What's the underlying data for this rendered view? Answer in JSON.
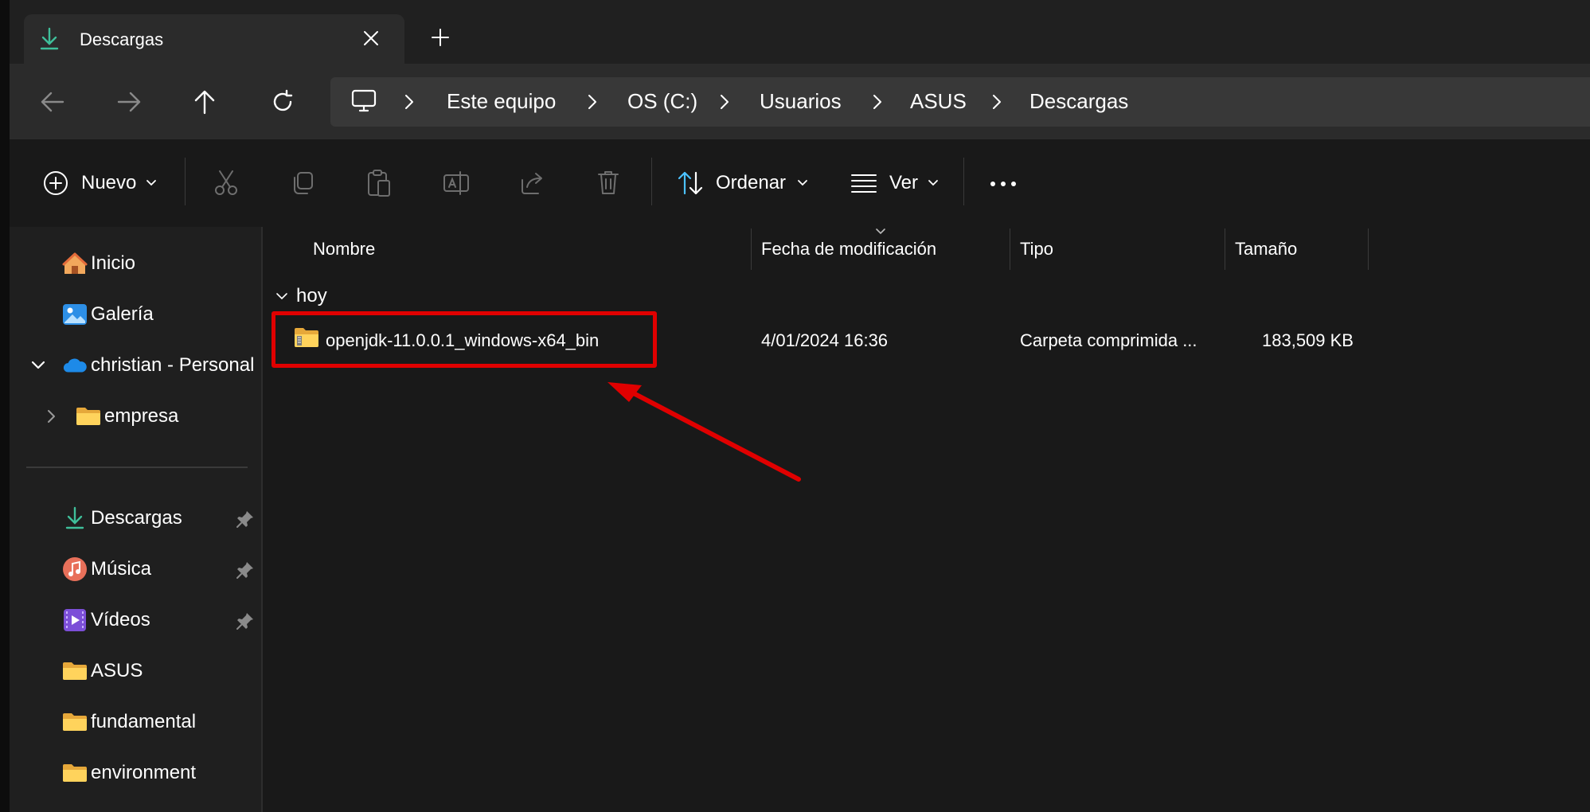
{
  "tab": {
    "title": "Descargas",
    "icon": "download-icon"
  },
  "nav": {
    "back": "arrow-left-icon",
    "forward": "arrow-right-icon",
    "up": "arrow-up-icon",
    "refresh": "refresh-icon"
  },
  "breadcrumb": [
    "Este equipo",
    "OS (C:)",
    "Usuarios",
    "ASUS",
    "Descargas"
  ],
  "toolbar": {
    "new_label": "Nuevo",
    "sort_label": "Ordenar",
    "view_label": "Ver"
  },
  "sidebar": {
    "items": [
      {
        "label": "Inicio",
        "icon": "home-icon"
      },
      {
        "label": "Galería",
        "icon": "gallery-icon"
      },
      {
        "label": "christian - Personal",
        "icon": "onedrive-icon"
      },
      {
        "label": "empresa",
        "icon": "folder-icon"
      }
    ],
    "quick_access": [
      {
        "label": "Descargas",
        "icon": "download-icon",
        "pinned": true
      },
      {
        "label": "Música",
        "icon": "music-icon",
        "pinned": true
      },
      {
        "label": "Vídeos",
        "icon": "video-icon",
        "pinned": true
      },
      {
        "label": "ASUS",
        "icon": "folder-icon",
        "pinned": false
      },
      {
        "label": "fundamental",
        "icon": "folder-icon",
        "pinned": false
      },
      {
        "label": "environment",
        "icon": "folder-icon",
        "pinned": false
      }
    ]
  },
  "columns": {
    "name": "Nombre",
    "date": "Fecha de modificación",
    "type": "Tipo",
    "size": "Tamaño"
  },
  "group": {
    "label": "hoy"
  },
  "files": [
    {
      "name": "openjdk-11.0.0.1_windows-x64_bin",
      "date": "4/01/2024 16:36",
      "type": "Carpeta comprimida ...",
      "size": "183,509 KB",
      "icon": "zip-folder-icon"
    }
  ],
  "colors": {
    "highlight": "#e00000",
    "background": "#191919",
    "folder": "#f5c84c",
    "accent": "#4cc2ff"
  }
}
